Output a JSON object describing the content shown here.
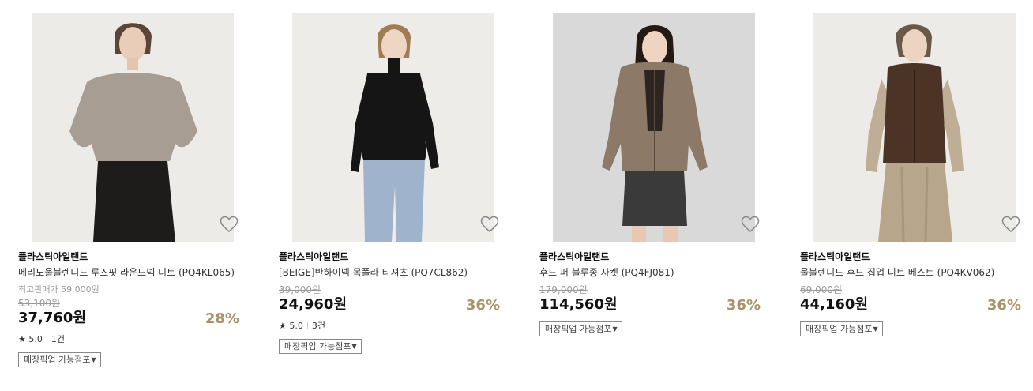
{
  "products": [
    {
      "brand": "플라스틱아일랜드",
      "name": "메리노울블렌디드 루즈핏 라운드넥 니트 (PQ4KL065)",
      "best_price": "최고판매가 59,000원",
      "original_price": "53,100원",
      "price": "37,760원",
      "discount": "28%",
      "rating": "★ 5.0",
      "reviews": "1건",
      "pickup_label": "매장픽업 가능점포",
      "icons": [
        "heart-icon",
        "dropdown-arrow-icon"
      ]
    },
    {
      "brand": "플라스틱아일랜드",
      "name": "[BEIGE]반하이넥 목폴라 티셔츠 (PQ7CL862)",
      "original_price": "39,000원",
      "price": "24,960원",
      "discount": "36%",
      "rating": "★ 5.0",
      "reviews": "3건",
      "pickup_label": "매장픽업 가능점포",
      "icons": [
        "heart-icon",
        "dropdown-arrow-icon"
      ]
    },
    {
      "brand": "플라스틱아일랜드",
      "name": "후드 퍼 블루종 자켓 (PQ4FJ081)",
      "original_price": "179,000원",
      "price": "114,560원",
      "discount": "36%",
      "pickup_label": "매장픽업 가능점포",
      "icons": [
        "heart-icon",
        "dropdown-arrow-icon"
      ]
    },
    {
      "brand": "플라스틱아일랜드",
      "name": "울블렌디드 후드 집업 니트 베스트 (PQ4KV062)",
      "original_price": "69,000원",
      "price": "44,160원",
      "discount": "36%",
      "pickup_label": "매장픽업 가능점포",
      "icons": [
        "heart-icon",
        "dropdown-arrow-icon"
      ]
    }
  ],
  "colors": {
    "discount": "#a89369",
    "strike_price": "#9a9a9a",
    "image_bg_light": "#eeece9",
    "image_bg_gray": "#dadada"
  }
}
